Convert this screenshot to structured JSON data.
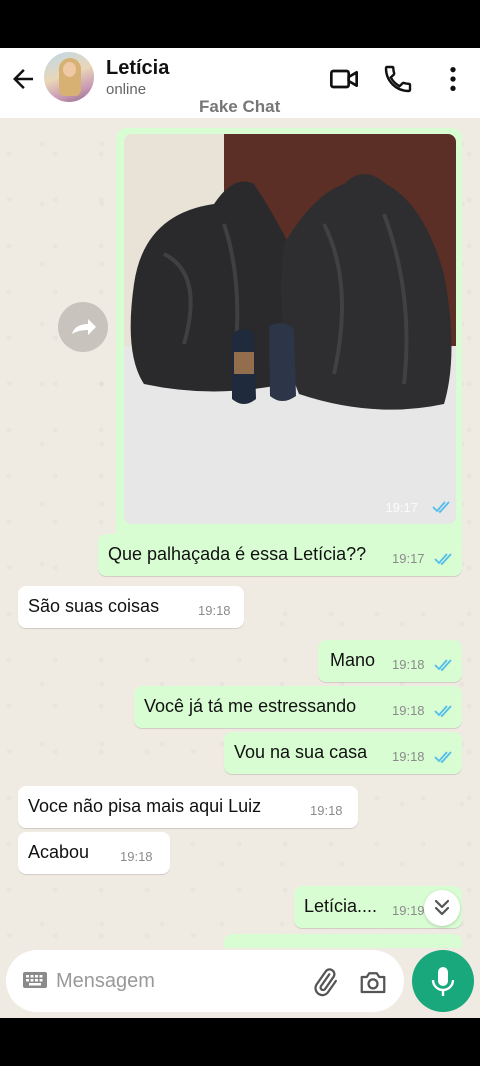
{
  "header": {
    "contact_name": "Letícia",
    "status": "online",
    "watermark": "Fake Chat"
  },
  "image_message": {
    "time": "19:17",
    "read": true
  },
  "messages": [
    {
      "direction": "out",
      "text": "Que palhaçada é essa Letícia??",
      "time": "19:17",
      "read": true
    },
    {
      "direction": "in",
      "text": "São suas coisas",
      "time": "19:18"
    },
    {
      "direction": "out",
      "text": "Mano",
      "time": "19:18",
      "read": true
    },
    {
      "direction": "out",
      "text": "Você já tá me estressando",
      "time": "19:18",
      "read": true
    },
    {
      "direction": "out",
      "text": "Vou na sua casa",
      "time": "19:18",
      "read": true
    },
    {
      "direction": "in",
      "text": "Voce não pisa mais aqui Luiz",
      "time": "19:18"
    },
    {
      "direction": "in",
      "text": "Acabou",
      "time": "19:18"
    },
    {
      "direction": "out",
      "text": "Letícia....",
      "time": "19:19",
      "read": true
    }
  ],
  "input": {
    "placeholder": "Mensagem"
  },
  "icons": {
    "back": "arrow-left-icon",
    "video": "video-camera-icon",
    "call": "phone-icon",
    "menu": "more-vertical-icon",
    "forward": "forward-icon",
    "scroll": "chevron-double-down-icon",
    "keyboard": "keyboard-icon",
    "attach": "paperclip-icon",
    "camera": "camera-icon",
    "mic": "microphone-icon"
  },
  "colors": {
    "outgoing_bubble": "#d9fdd3",
    "incoming_bubble": "#ffffff",
    "chat_background": "#efeae2",
    "read_ticks": "#53bdeb",
    "mic_button": "#19a77c"
  }
}
